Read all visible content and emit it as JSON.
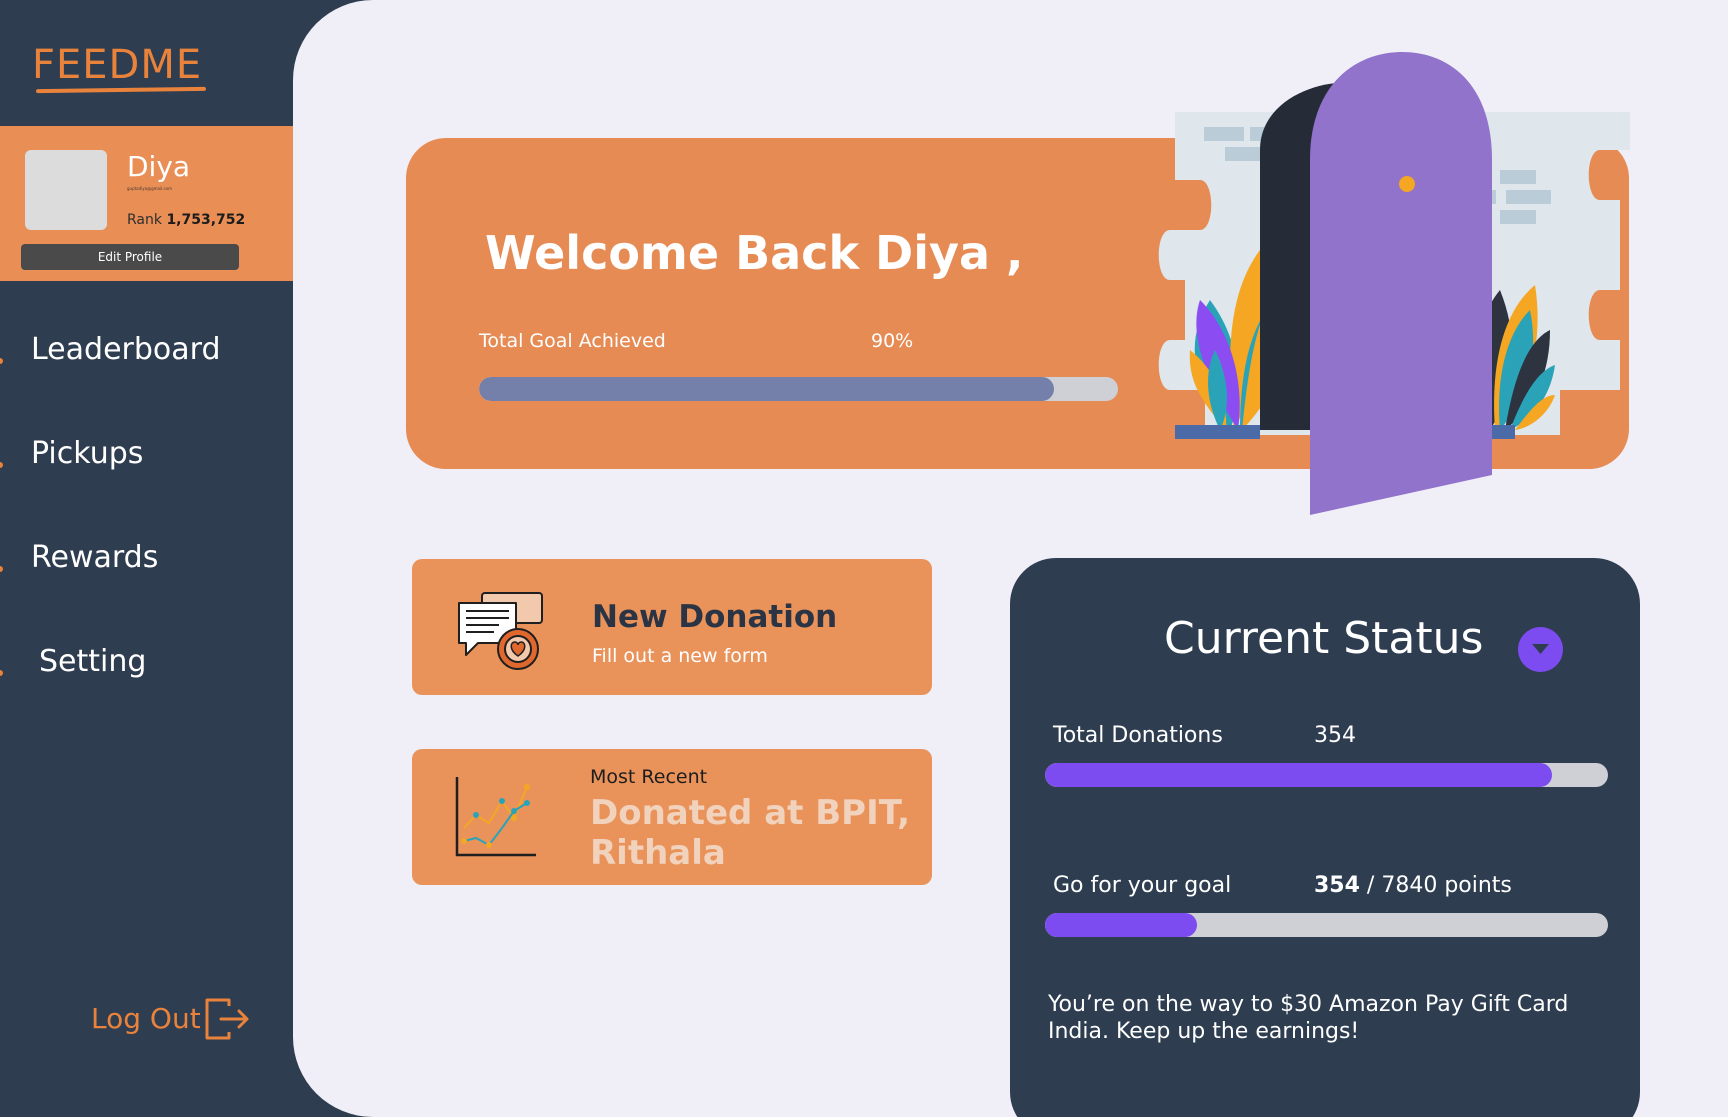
{
  "app": {
    "logo": "FEEDME"
  },
  "profile": {
    "name": "Diya",
    "email": "guptadiya@gmail.com",
    "rank_label": "Rank",
    "rank_value": "1,753,752",
    "edit_label": "Edit Profile"
  },
  "nav": {
    "items": [
      {
        "label": "Leaderboard"
      },
      {
        "label": "Pickups"
      },
      {
        "label": "Rewards"
      },
      {
        "label": "Setting"
      }
    ],
    "logout_label": "Log Out"
  },
  "welcome": {
    "title": "Welcome Back Diya ,",
    "goal_label": "Total Goal Achieved",
    "goal_percent_text": "90%",
    "goal_progress": 0.9
  },
  "new_donation": {
    "title": "New Donation",
    "subtitle": "Fill out a new form"
  },
  "recent": {
    "label": "Most Recent",
    "title": "Donated at BPIT, Rithala"
  },
  "status": {
    "title": "Current Status",
    "donations_label": "Total Donations",
    "donations_value": "354",
    "donations_progress": 0.9,
    "goal_label": "Go for your goal",
    "goal_points_current": "354",
    "goal_points_rest": " / 7840  points",
    "goal_progress": 0.27,
    "message": "You’re on the way to $30 Amazon Pay Gift Card India. Keep up the earnings!"
  },
  "colors": {
    "sidebar": "#2e3d50",
    "accent_orange": "#e9833c",
    "card_orange": "#e68b54",
    "purple": "#7d4cf0",
    "page_bg": "#f0eff7"
  },
  "icons": [
    "logout-icon",
    "chat-heart-icon",
    "line-chart-icon",
    "chevron-down-icon"
  ]
}
